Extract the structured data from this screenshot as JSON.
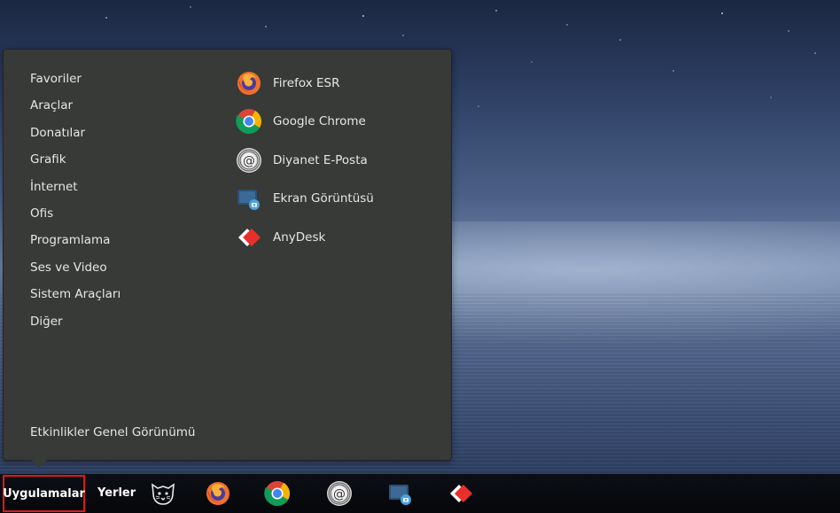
{
  "menu": {
    "categories": [
      "Favoriler",
      "Araçlar",
      "Donatılar",
      "Grafik",
      "İnternet",
      "Ofis",
      "Programlama",
      "Ses ve Video",
      "Sistem Araçları",
      "Diğer"
    ],
    "apps": [
      {
        "label": "Firefox ESR",
        "icon": "firefox-icon"
      },
      {
        "label": "Google Chrome",
        "icon": "chrome-icon"
      },
      {
        "label": "Diyanet E-Posta",
        "icon": "email-at-icon"
      },
      {
        "label": "Ekran Görüntüsü",
        "icon": "screenshot-icon"
      },
      {
        "label": "AnyDesk",
        "icon": "anydesk-icon"
      }
    ],
    "overview_label": "Etkinlikler Genel Görünümü"
  },
  "taskbar": {
    "applications_label": "Uygulamalar",
    "places_label": "Yerler",
    "highlight_color": "#e01818",
    "pinned": [
      "pardus-cat-icon",
      "firefox-icon",
      "chrome-icon",
      "email-at-icon",
      "screenshot-icon",
      "anydesk-icon"
    ]
  }
}
